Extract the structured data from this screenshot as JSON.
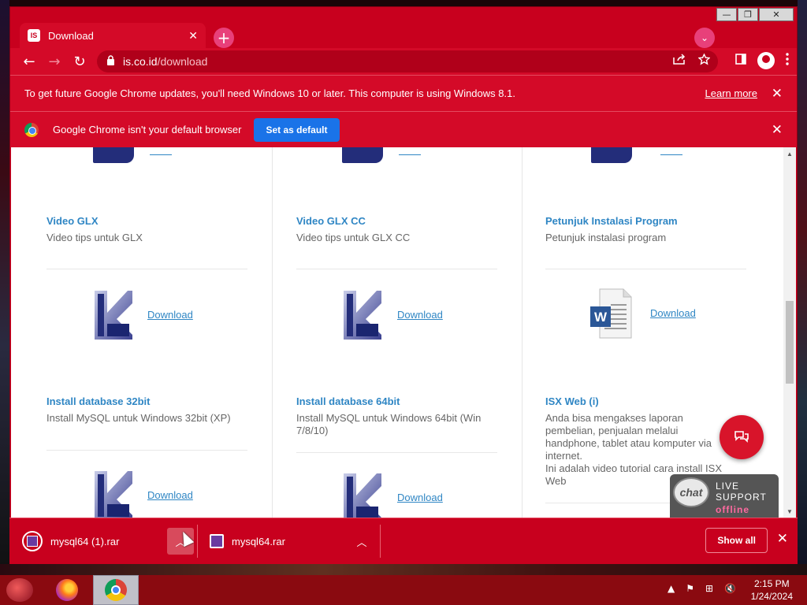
{
  "window": {
    "controls": {
      "minimize": "—",
      "restore": "❐",
      "close": "✕"
    }
  },
  "tab": {
    "title": "Download",
    "favicon": "IS",
    "close": "✕"
  },
  "newtab_symbol": "+",
  "tabsearch_symbol": "⌄",
  "toolbar": {
    "back": "←",
    "forward": "→",
    "reload": "↻",
    "url_host": "is.co.id",
    "url_path": "/download"
  },
  "update_bar": {
    "message": "To get future Google Chrome updates, you'll need Windows 10 or later. This computer is using Windows 8.1.",
    "link": "Learn more",
    "close": "✕"
  },
  "default_bar": {
    "message": "Google Chrome isn't your default browser",
    "button": "Set as default",
    "close": "✕"
  },
  "items": [
    {
      "title": "Video GLX",
      "desc": "Video tips untuk GLX"
    },
    {
      "title": "Video GLX CC",
      "desc": "Video tips untuk GLX CC"
    },
    {
      "title": "Petunjuk Instalasi Program",
      "desc": "Petunjuk instalasi program"
    },
    {
      "title": "Install database 32bit",
      "desc": "Install MySQL untuk Windows 32bit (XP)"
    },
    {
      "title": "Install database 64bit",
      "desc": "Install MySQL untuk Windows 64bit (Win 7/8/10)"
    },
    {
      "title": "ISX Web (i)",
      "desc": "Anda bisa mengakses laporan pembelian, penjualan melalui handphone, tablet atau komputer via internet.\nIni adalah video tutorial cara install ISX Web"
    }
  ],
  "download_label": "Download",
  "word_icon_letter": "W",
  "live_support": {
    "bubble": "chat",
    "line1": "LIVE",
    "line2": "SUPPORT",
    "status": "offline"
  },
  "downloads": [
    {
      "name": "mysql64 (1).rar"
    },
    {
      "name": "mysql64.rar"
    }
  ],
  "downloads_bar": {
    "show_all": "Show all",
    "close": "✕",
    "chevron": "︿"
  },
  "taskbar": {
    "time": "2:15 PM",
    "date": "1/24/2024",
    "tray": [
      "▲",
      "⚑",
      "⊞",
      "🔇"
    ]
  },
  "icons": {
    "tab_favicon": "is-logo-icon",
    "new_tab": "plus-icon",
    "tab_search": "chevron-down-icon",
    "back": "arrow-left-icon",
    "forward": "arrow-right-icon",
    "reload": "reload-icon",
    "lock": "lock-icon",
    "share": "share-icon",
    "bookmark": "star-icon",
    "sidepanel": "side-panel-icon",
    "profile": "profile-icon",
    "menu": "kebab-menu-icon"
  },
  "colors": {
    "chrome_theme": "#c8001e",
    "link": "#2f86c4",
    "primary_button": "#1a73e8",
    "chat_fab": "#d8142a",
    "offline": "#ff6aa0"
  }
}
